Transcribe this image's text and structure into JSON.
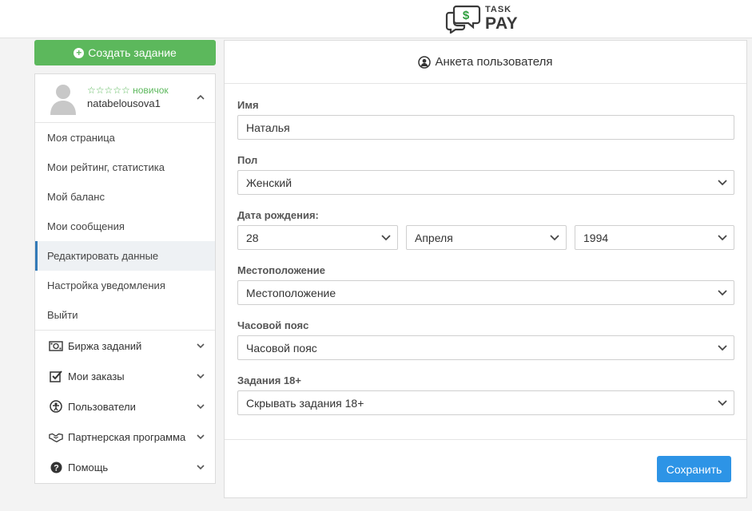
{
  "logo": {
    "line1": "TASK",
    "line2": "PAY",
    "dollar": "$"
  },
  "sidebar": {
    "create_button": "Создать задание",
    "profile": {
      "rank": "☆☆☆☆☆ новичок",
      "username": "natabelousova1"
    },
    "menu": [
      {
        "label": "Моя страница"
      },
      {
        "label": "Мои рейтинг, статистика"
      },
      {
        "label": "Мой баланс"
      },
      {
        "label": "Мои сообщения"
      },
      {
        "label": "Редактировать данные"
      },
      {
        "label": "Настройка уведомления"
      },
      {
        "label": "Выйти"
      }
    ],
    "nav": [
      {
        "label": "Биржа заданий",
        "icon": "money-icon"
      },
      {
        "label": "Мои заказы",
        "icon": "checkbox-icon"
      },
      {
        "label": "Пользователи",
        "icon": "users-icon"
      },
      {
        "label": "Партнерская программа",
        "icon": "handshake-icon"
      },
      {
        "label": "Помощь",
        "icon": "help-icon"
      }
    ]
  },
  "form": {
    "title": "Анкета пользователя",
    "name": {
      "label": "Имя",
      "value": "Наталья"
    },
    "gender": {
      "label": "Пол",
      "value": "Женский"
    },
    "birth": {
      "label": "Дата рождения:",
      "day": "28",
      "month": "Апреля",
      "year": "1994"
    },
    "location": {
      "label": "Местоположение",
      "value": "Местоположение"
    },
    "timezone": {
      "label": "Часовой пояс",
      "value": "Часовой пояс"
    },
    "adult": {
      "label": "Задания 18+",
      "value": "Скрывать задания 18+"
    },
    "save": "Сохранить"
  },
  "colors": {
    "green": "#5cb85c",
    "blue": "#2d94e6",
    "active_border": "#337ab7"
  }
}
